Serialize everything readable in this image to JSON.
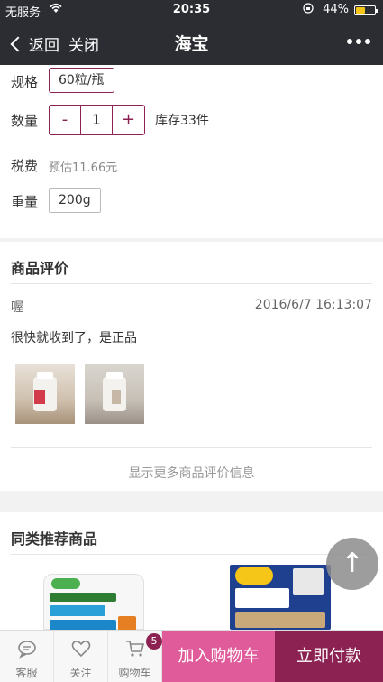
{
  "status": {
    "carrier": "无服务",
    "time": "20:35",
    "battery": "44%",
    "battery_level": 0.44
  },
  "nav": {
    "back_label": "返回",
    "close_label": "关闭",
    "title": "海宝"
  },
  "spec": {
    "spec_label": "规格",
    "spec_value": "60粒/瓶",
    "qty_label": "数量",
    "qty_minus": "-",
    "qty_value": "1",
    "qty_plus": "+",
    "stock": "库存33件",
    "tax_label": "税费",
    "tax_value": "预估11.66元",
    "weight_label": "重量",
    "weight_value": "200g"
  },
  "reviews": {
    "title": "商品评价",
    "reviewer": "喔",
    "time": "2016/6/7 16:13:07",
    "text": "很快就收到了，是正品",
    "more_label": "显示更多商品评价信息"
  },
  "recommend": {
    "title": "同类推荐商品"
  },
  "scroll_top": "↑",
  "bottom": {
    "service_label": "客服",
    "follow_label": "关注",
    "cart_label": "购物车",
    "cart_count": "5",
    "add_cart_label": "加入购物车",
    "buy_label": "立即付款"
  },
  "colors": {
    "brand": "#8b2252",
    "accent": "#e05b9a",
    "nav_bg": "#2b2d33"
  }
}
